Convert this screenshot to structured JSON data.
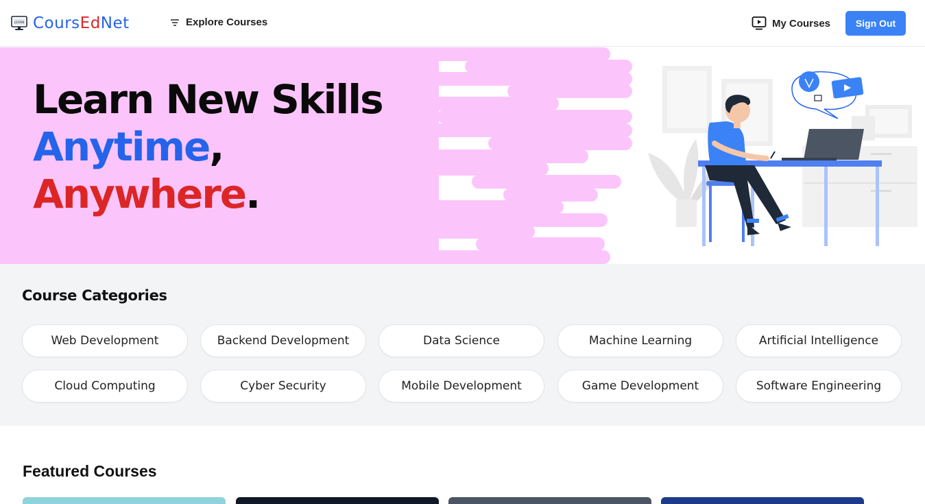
{
  "header": {
    "logo": {
      "part1": "Cours",
      "part2": "Ed",
      "part3": "Net"
    },
    "explore_label": "Explore Courses",
    "my_courses_label": "My Courses",
    "sign_out_label": "Sign Out"
  },
  "hero": {
    "line1": "Learn New Skills",
    "line2_highlight": "Anytime",
    "line2_punct": ",",
    "line3_highlight": "Anywhere",
    "line3_punct": "."
  },
  "categories": {
    "title": "Course Categories",
    "items": [
      {
        "label": "Web Development"
      },
      {
        "label": "Backend Development"
      },
      {
        "label": "Data Science"
      },
      {
        "label": "Machine Learning"
      },
      {
        "label": "Artificial Intelligence"
      },
      {
        "label": "Cloud Computing"
      },
      {
        "label": "Cyber Security"
      },
      {
        "label": "Mobile Development"
      },
      {
        "label": "Game Development"
      },
      {
        "label": "Software Engineering"
      }
    ]
  },
  "featured": {
    "title": "Featured Courses"
  },
  "colors": {
    "brand_blue": "#2563eb",
    "brand_red": "#dc2626",
    "button_blue": "#3b82f6",
    "hero_pink": "#fbc5fb",
    "section_gray": "#f3f4f6"
  },
  "icons": {
    "logo": "monitor-logo-icon",
    "explore": "filter-lines-icon",
    "my_courses": "play-screen-icon"
  }
}
